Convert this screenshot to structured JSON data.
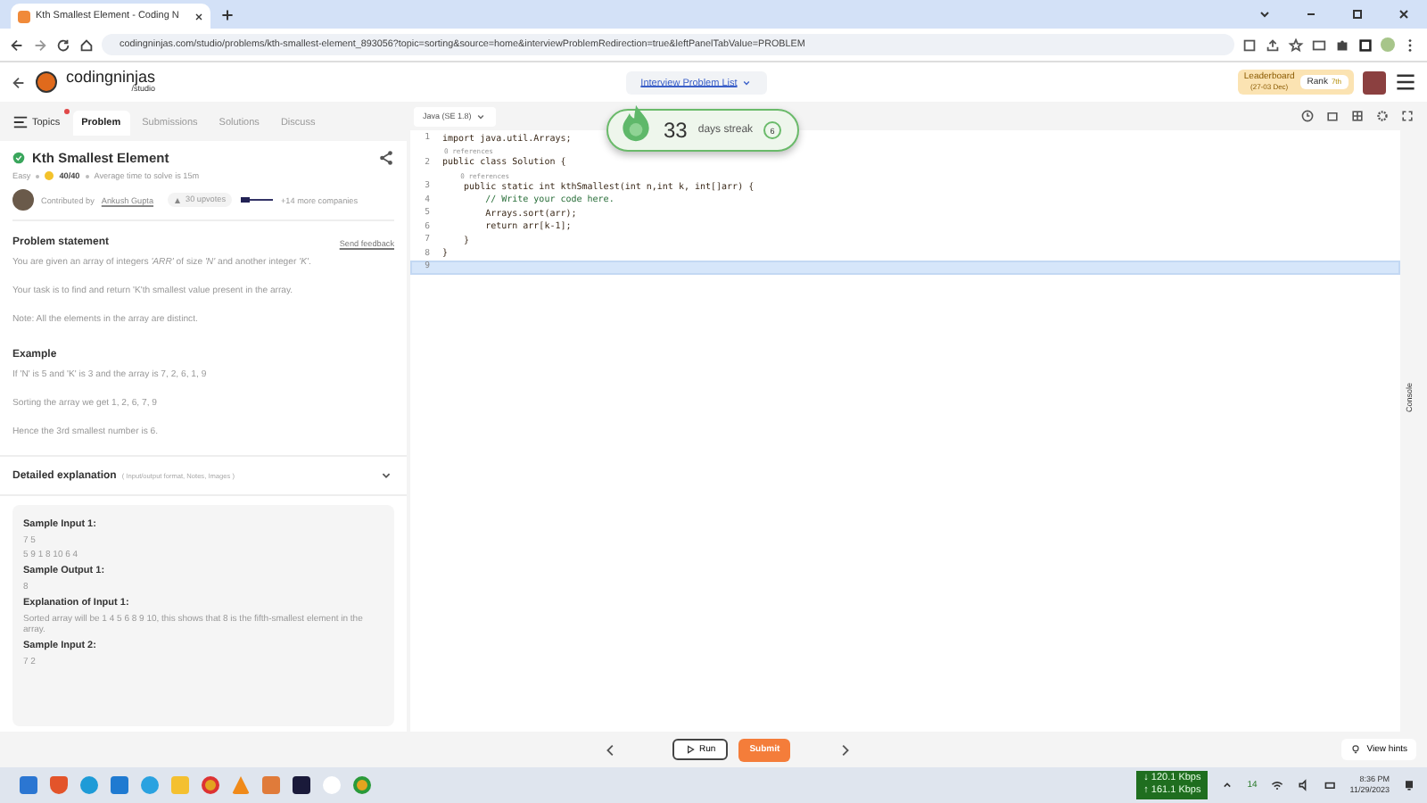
{
  "browser": {
    "tab_title": "Kth Smallest Element - Coding N",
    "url": "codingninjas.com/studio/problems/kth-smallest-element_893056?topic=sorting&source=home&interviewProblemRedirection=true&leftPanelTabValue=PROBLEM"
  },
  "header": {
    "logo": "codingninjas",
    "logo_sub": "/studio",
    "problem_list": "Interview Problem List",
    "leaderboard": "Leaderboard",
    "leaderboard_dates": "(27-03 Dec)",
    "rank": "Rank",
    "rank_value": "7th"
  },
  "tabs": [
    {
      "label": "Topics",
      "selected": false,
      "dot": true
    },
    {
      "label": "Problem",
      "selected": true,
      "dot": false
    },
    {
      "label": "Submissions",
      "selected": false,
      "dot": false
    },
    {
      "label": "Solutions",
      "selected": false,
      "dot": false
    },
    {
      "label": "Discuss",
      "selected": false,
      "dot": false
    }
  ],
  "problem": {
    "title": "Kth Smallest Element",
    "solved": true,
    "difficulty": "Easy",
    "score": "40/40",
    "avg_time": "Average time to solve is 15m",
    "contributed_by": "Contributed by",
    "author": "Ankush Gupta",
    "upvotes": "30 upvotes",
    "companies": "+14 more companies"
  },
  "statement": {
    "heading": "Problem statement",
    "feedback": "Send feedback",
    "paragraphs": [
      "You are given an array of integers *'ARR'* of size *'N'* and another integer *'K'*.",
      "Your task is to find and return 'K'th smallest value present in the array.",
      "Note: All the elements in the array are distinct."
    ]
  },
  "example": {
    "heading": "Example",
    "paragraphs": [
      "If 'N' is 5 and 'K' is 3 and the array is 7, 2, 6, 1, 9",
      "Sorting the array we get 1, 2, 6, 7, 9",
      "Hence the 3rd smallest number is 6."
    ]
  },
  "explanation": {
    "heading": "Detailed explanation",
    "note": "( Input/output format, Notes, Images )",
    "expanded": true
  },
  "samples": [
    {
      "kind": "heading",
      "text": "Sample Input 1:"
    },
    {
      "kind": "text",
      "text": "7 5"
    },
    {
      "kind": "text",
      "text": "5 9 1 8 10 6 4"
    },
    {
      "kind": "heading",
      "text": "Sample Output 1:"
    },
    {
      "kind": "text",
      "text": "8"
    },
    {
      "kind": "heading",
      "text": "Explanation of Input 1:"
    },
    {
      "kind": "text",
      "text": "Sorted array will be 1 4 5 6 8 9 10, this shows that 8 is the fifth-smallest element in the array."
    },
    {
      "kind": "heading",
      "text": "Sample Input 2:"
    },
    {
      "kind": "text",
      "text": "7 2"
    }
  ],
  "editor": {
    "language": "Java (SE 1.8)",
    "console": "Console",
    "lines": [
      {
        "kind": "code",
        "number": "1",
        "text": "import java.util.Arrays;",
        "active": false
      },
      {
        "kind": "annotation",
        "text": "0 references"
      },
      {
        "kind": "code",
        "number": "2",
        "text": "public class Solution {",
        "active": false
      },
      {
        "kind": "annotation",
        "text": "    0 references"
      },
      {
        "kind": "code",
        "number": "3",
        "text": "    public static int kthSmallest(int n,int k, int[]arr) {",
        "active": false
      },
      {
        "kind": "comment",
        "number": "4",
        "text": "        // Write your code here.",
        "active": false
      },
      {
        "kind": "code",
        "number": "5",
        "text": "        Arrays.sort(arr);",
        "active": false
      },
      {
        "kind": "code",
        "number": "6",
        "text": "        return arr[k-1];",
        "active": false
      },
      {
        "kind": "code",
        "number": "7",
        "text": "    }",
        "active": false
      },
      {
        "kind": "code",
        "number": "8",
        "text": "}",
        "active": false
      },
      {
        "kind": "code",
        "number": "9",
        "active": true
      }
    ]
  },
  "streak": {
    "days": "33",
    "label": "days streak",
    "freezes": "6"
  },
  "footer": {
    "run": "Run",
    "submit": "Submit",
    "hints": "View hints"
  },
  "taskbar": {
    "download": "↓ 120.1 Kbps",
    "upload": "↑ 161.1 Kbps",
    "count": "14",
    "time": "8:36 PM",
    "date": "11/29/2023"
  }
}
